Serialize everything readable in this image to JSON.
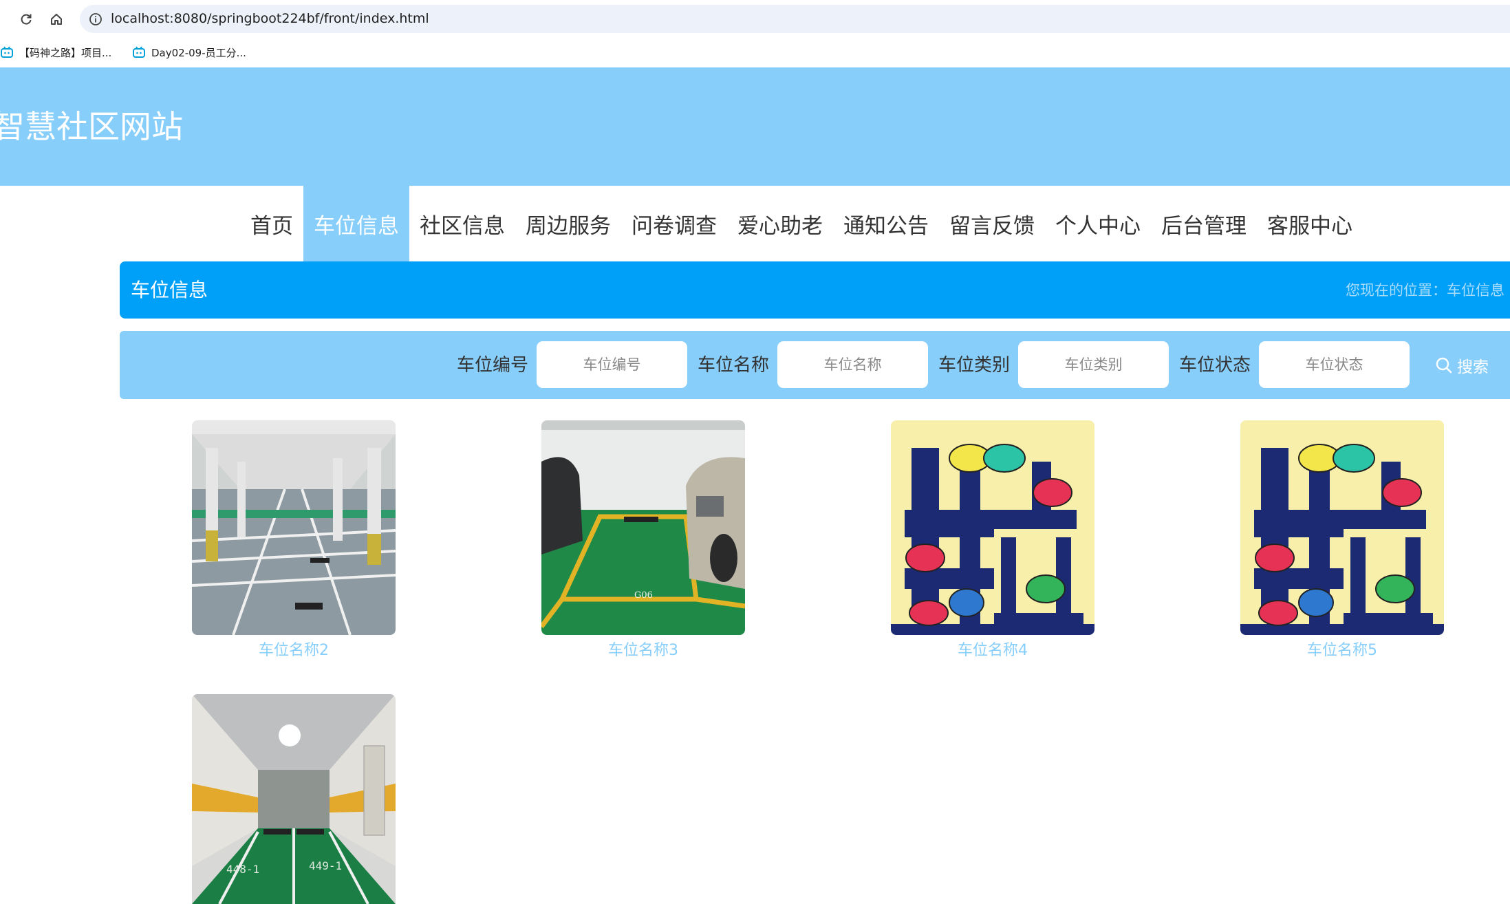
{
  "browser": {
    "url": "localhost:8080/springboot224bf/front/index.html",
    "bookmarks": [
      "【码神之路】项目...",
      "Day02-09-员工分..."
    ]
  },
  "site": {
    "title": "智慧社区网站"
  },
  "nav": {
    "items": [
      {
        "label": "首页"
      },
      {
        "label": "车位信息"
      },
      {
        "label": "社区信息"
      },
      {
        "label": "周边服务"
      },
      {
        "label": "问卷调查"
      },
      {
        "label": "爱心助老"
      },
      {
        "label": "通知公告"
      },
      {
        "label": "留言反馈"
      },
      {
        "label": "个人中心"
      },
      {
        "label": "后台管理"
      },
      {
        "label": "客服中心"
      }
    ],
    "active_index": 1
  },
  "breadcrumb": {
    "title": "车位信息",
    "location": "您现在的位置：车位信息"
  },
  "search": {
    "fields": [
      {
        "label": "车位编号",
        "placeholder": "车位编号",
        "value": ""
      },
      {
        "label": "车位名称",
        "placeholder": "车位名称",
        "value": ""
      },
      {
        "label": "车位类别",
        "placeholder": "车位类别",
        "value": ""
      },
      {
        "label": "车位状态",
        "placeholder": "车位状态",
        "value": ""
      }
    ],
    "button_label": "搜索",
    "button_icon": "search-icon"
  },
  "cards": [
    {
      "name": "车位名称2",
      "image": "garage-photo"
    },
    {
      "name": "车位名称3",
      "image": "green-parking-space-photo"
    },
    {
      "name": "车位名称4",
      "image": "parking-logo-illustration"
    },
    {
      "name": "车位名称5",
      "image": "parking-logo-illustration"
    },
    {
      "name": "",
      "image": "underground-corridor-photo"
    }
  ],
  "colors": {
    "header_bg": "#87cefa",
    "crumb_bg": "#00a0f8",
    "card_name": "#87cefa"
  }
}
